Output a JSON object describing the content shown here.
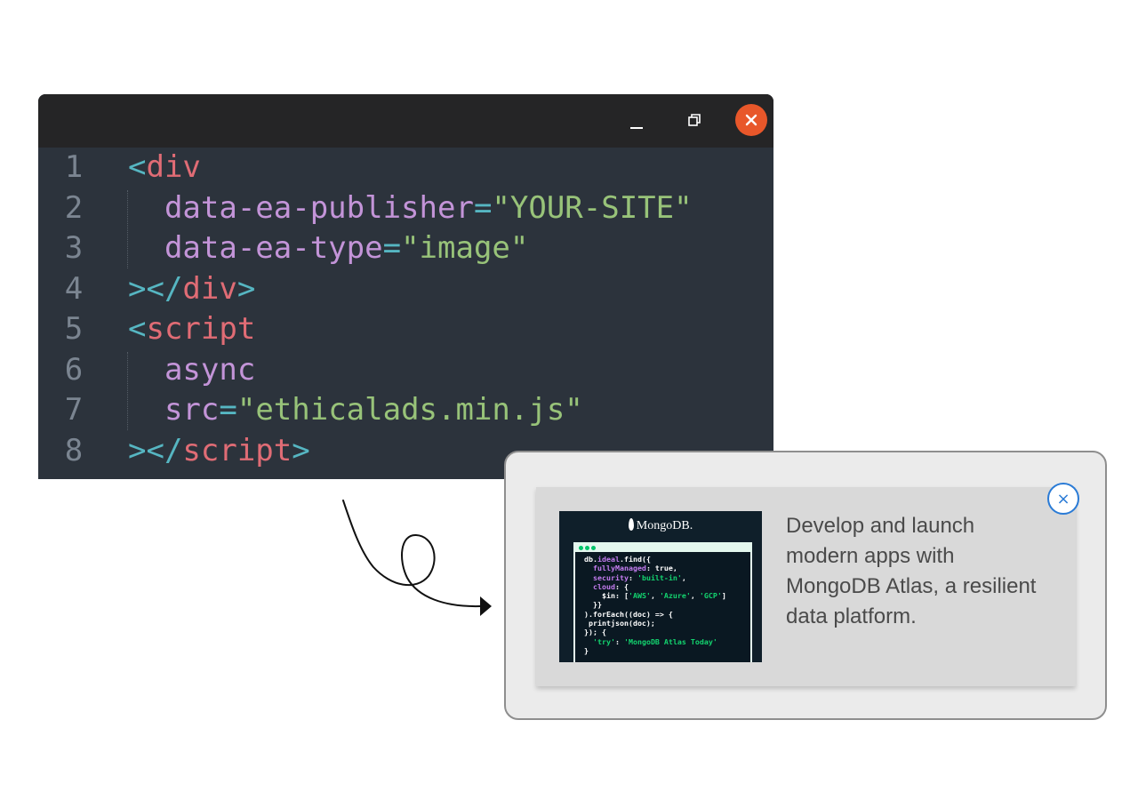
{
  "editor": {
    "window_controls": {
      "minimize": "minimize-icon",
      "maximize": "restore-icon",
      "close": "close-icon",
      "close_color": "#e8572a"
    },
    "lines": [
      {
        "n": "1",
        "code": [
          {
            "c": "p",
            "t": "<"
          },
          {
            "c": "t",
            "t": "div"
          }
        ]
      },
      {
        "n": "2",
        "code": [
          {
            "c": "a",
            "t": "  data-ea-publisher"
          },
          {
            "c": "e",
            "t": "="
          },
          {
            "c": "s",
            "t": "\"YOUR-SITE\""
          }
        ]
      },
      {
        "n": "3",
        "code": [
          {
            "c": "a",
            "t": "  data-ea-type"
          },
          {
            "c": "e",
            "t": "="
          },
          {
            "c": "s",
            "t": "\"image\""
          }
        ]
      },
      {
        "n": "4",
        "code": [
          {
            "c": "p",
            "t": "></"
          },
          {
            "c": "t",
            "t": "div"
          },
          {
            "c": "p",
            "t": ">"
          }
        ]
      },
      {
        "n": "5",
        "code": [
          {
            "c": "p",
            "t": "<"
          },
          {
            "c": "t",
            "t": "script"
          }
        ]
      },
      {
        "n": "6",
        "code": [
          {
            "c": "a",
            "t": "  async"
          }
        ]
      },
      {
        "n": "7",
        "code": [
          {
            "c": "a",
            "t": "  src"
          },
          {
            "c": "e",
            "t": "="
          },
          {
            "c": "s",
            "t": "\"ethicalads.min.js\""
          }
        ]
      },
      {
        "n": "8",
        "code": [
          {
            "c": "p",
            "t": "></"
          },
          {
            "c": "t",
            "t": "script"
          },
          {
            "c": "p",
            "t": ">"
          }
        ]
      }
    ]
  },
  "ad": {
    "image": {
      "brand": "MongoDB.",
      "code_lines": [
        [
          {
            "c": "",
            "t": "db."
          },
          {
            "c": "k",
            "t": "ideal"
          },
          {
            "c": "",
            "t": ".find({"
          }
        ],
        [
          {
            "c": "k",
            "t": "  fullyManaged"
          },
          {
            "c": "",
            "t": ": true,"
          }
        ],
        [
          {
            "c": "k",
            "t": "  security"
          },
          {
            "c": "",
            "t": ": "
          },
          {
            "c": "g",
            "t": "'built-in'"
          },
          {
            "c": "",
            "t": ","
          }
        ],
        [
          {
            "c": "k",
            "t": "  cloud"
          },
          {
            "c": "",
            "t": ": {"
          }
        ],
        [
          {
            "c": "",
            "t": "    $in: ["
          },
          {
            "c": "g",
            "t": "'AWS'"
          },
          {
            "c": "",
            "t": ", "
          },
          {
            "c": "g",
            "t": "'Azure'"
          },
          {
            "c": "",
            "t": ", "
          },
          {
            "c": "g",
            "t": "'GCP'"
          },
          {
            "c": "",
            "t": "]"
          }
        ],
        [
          {
            "c": "",
            "t": "  }}"
          }
        ],
        [
          {
            "c": "",
            "t": ").forEach((doc) => {"
          }
        ],
        [
          {
            "c": "",
            "t": " printjson(doc);"
          }
        ],
        [
          {
            "c": "",
            "t": "}); {"
          }
        ],
        [
          {
            "c": "g",
            "t": "  'try'"
          },
          {
            "c": "",
            "t": ": "
          },
          {
            "c": "g",
            "t": "'MongoDB Atlas Today'"
          }
        ],
        [
          {
            "c": "",
            "t": "}"
          }
        ]
      ]
    },
    "text": "Develop and launch modern apps with MongoDB Atlas, a resilient data platform.",
    "close_label": "×"
  }
}
